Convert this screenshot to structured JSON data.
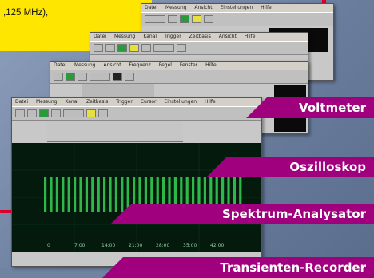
{
  "intro": {
    "text": ",125 MHz),"
  },
  "windows": {
    "voltmeter": {
      "menu": [
        "Datei",
        "Messung",
        "Ansicht",
        "Einstellungen",
        "Hilfe"
      ]
    },
    "oscilloscope": {
      "menu": [
        "Datei",
        "Messung",
        "Kanal",
        "Trigger",
        "Zeitbasis",
        "Ansicht",
        "Hilfe"
      ]
    },
    "analyzer": {
      "menu": [
        "Datei",
        "Messung",
        "Ansicht",
        "Frequenz",
        "Pegel",
        "Fenster",
        "Hilfe"
      ]
    },
    "logger": {
      "menu": [
        "Datei",
        "Messung",
        "Kanal",
        "Zeitbasis",
        "Trigger",
        "Cursor",
        "Einstellungen",
        "Hilfe"
      ],
      "time_ticks": [
        "0",
        "7:00",
        "14:00",
        "21:00",
        "28:00",
        "35:00",
        "42:00"
      ]
    }
  },
  "labels": {
    "voltmeter": "Voltmeter",
    "oscilloscope": "Oszilloskop",
    "spectrum": "Spektrum-Analysator",
    "recorder": "Transienten-Recorder"
  },
  "colors": {
    "accent_purple": "#a0007e",
    "accent_yellow": "#ffe600",
    "accent_red": "#d8002c",
    "trace_green": "#2fb84a"
  }
}
